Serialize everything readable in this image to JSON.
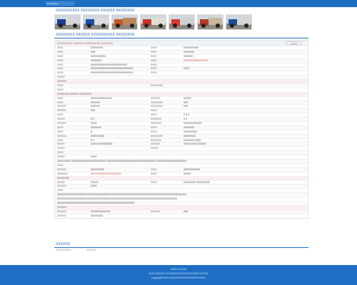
{
  "nav": {
    "current_label": "Homepage ›"
  },
  "page": {
    "title": "XXXXXXXXXX XXXXXXXX XXXXXX XXXXXXXX",
    "section_title": "XXXXXXXX XXXXXX XXXXXXXXXX XXXXXXXX"
  },
  "thumbs": [
    {
      "name": "truck-photo-1",
      "cab": "#1c3f8f",
      "box": "#d7d7d7"
    },
    {
      "name": "truck-photo-2",
      "cab": "#1c4fa2",
      "box": "#dcdcdc"
    },
    {
      "name": "truck-photo-3",
      "cab": "#c4572e",
      "box": "#b98a5c"
    },
    {
      "name": "truck-photo-4",
      "cab": "#cc3528",
      "box": "#e3ddd5"
    },
    {
      "name": "truck-photo-5",
      "cab": "#d23a2e",
      "box": "#cfcfcf"
    },
    {
      "name": "truck-photo-6",
      "cab": "#b53a2d",
      "box": "#c9b79e"
    },
    {
      "name": "truck-photo-7",
      "cab": "#1f4e96",
      "box": "#d6d6d6"
    }
  ],
  "specs": {
    "header": "XXXXXXXX XXXXXX XXXXXXXX XXXXXX",
    "compare_label": "XXXXX",
    "rows": [
      {
        "k1": "XXXX",
        "v1": "XXXXXXXX",
        "k2": "XXXX",
        "v2": "XXXXXXXXXX"
      },
      {
        "k1": "XXXX",
        "v1": "XXX",
        "k2": "XXXX",
        "v2": "XXXXXXX"
      },
      {
        "k1": "XXXX",
        "v1": "XXXXXXXXXX",
        "k2": "XXXX",
        "v2": "XXXXXX"
      },
      {
        "k1": "XXXX",
        "v1": "XXXXXXX",
        "k2": "XXXX",
        "v2": "XXXXXXXXXXXXXXXX",
        "red2": true
      },
      {
        "k1": "XXXX",
        "v1": "XXXXXXXXXXXXXXXXXXXXXXXX",
        "k2": "XXXX",
        "v2": ""
      },
      {
        "k1": "XXXX",
        "v1": "XXXXXXXXXXXXXXXXXXXXXXXXXXXX",
        "k2": "XXXX",
        "v2": "XXXX"
      },
      {
        "k1": "XXXX",
        "v1": "XXXXXXXXXXXXXXXXXXXXXXXXXXXX",
        "k2": "XXXX",
        "v2": ""
      },
      {
        "k1": "XXXXX",
        "v1": "",
        "k2": "",
        "v2": ""
      },
      {
        "head": true,
        "k1": "XXXXXX",
        "v1": "",
        "k2": "",
        "v2": ""
      },
      {
        "k1": "XXXX",
        "v1": "",
        "k2": "XXXXXXXX",
        "v2": ""
      },
      {
        "k1": "XXXX",
        "v1": "",
        "k2": "",
        "v2": ""
      },
      {
        "head": true,
        "k1": "XXXXXXXX XXXXXX XXXXXXXX",
        "v1": "",
        "k2": "",
        "v2": ""
      },
      {
        "k1": "XXXX",
        "v1": "XXXXXXXXXXXXXX",
        "k2": "XXXXXX",
        "v2": "XXXXX"
      },
      {
        "k1": "XXXX",
        "v1": "XXXXXX",
        "k2": "XXXXXXXX",
        "v2": "XXX"
      },
      {
        "k1": "XXXXXX",
        "v1": "XXXXXX",
        "k2": "XXXXXXXX",
        "v2": "XXX"
      },
      {
        "k1": "XXXXXX",
        "v1": "XXX",
        "k2": "XXXX",
        "v2": ""
      },
      {
        "k1": "XXXX",
        "v1": "",
        "k2": "XXXX",
        "v2": "X X X"
      },
      {
        "k1": "XXXXX",
        "v1": "X X",
        "k2": "XXXXXXX",
        "v2": "X X"
      },
      {
        "k1": "XXXXXX",
        "v1": "XXXX",
        "k2": "XXXXXXX",
        "v2": "XXXXXXXXXXXX"
      },
      {
        "k1": "XXXX",
        "v1": "XXXXXXX",
        "k2": "XXXX",
        "v2": "XXXXXXX"
      },
      {
        "k1": "XXXX",
        "v1": "X",
        "k2": "XXXX",
        "v2": "XXXXXXXXX"
      },
      {
        "k1": "XXXXXX",
        "v1": "XXXXXXXXX",
        "k2": "XXXXXXXX",
        "v2": "XXXXXXXX"
      },
      {
        "k1": "XXXX",
        "v1": "X X",
        "k2": "XXXXXXX",
        "v2": "XXXXXXX XXXX"
      },
      {
        "k1": "XXXXX",
        "v1": "XXXX XXXXXXXXXX",
        "k2": "XXXXXX",
        "v2": "XXXX XXXX XXXXXX"
      },
      {
        "k1": "XXXXX",
        "v1": "",
        "k2": "XXXXX",
        "v2": ""
      },
      {
        "k1": "XXXX",
        "v1": "",
        "k2": "",
        "v2": ""
      },
      {
        "k1": "XXXXX",
        "v1": "XXXX",
        "k2": "",
        "v2": ""
      },
      {
        "long": "XXXXXXXXX XXXXXXXXXXXXXXXXXXXXXXX XXXXXXXXXXXXXXXXXXXXXXXXXXXXXXXX XXXXXXXXXXXXXXXXXXXX"
      },
      {
        "k1": "XXXX",
        "v1": "",
        "k2": "",
        "v2": ""
      },
      {
        "k1": "XXXXXX",
        "v1": "XXXXXXXXX",
        "k2": "XXXX",
        "v2": "XXXXXXXXXXX"
      },
      {
        "k1": "XXXXXXX",
        "v1": "XXXXXXXXXXXXXXXXXXXX",
        "k2": "XXXX",
        "v2": "XXXXX",
        "red1": true
      },
      {
        "head": true,
        "k1": "XXXXXXXX",
        "v1": "",
        "k2": "",
        "v2": ""
      },
      {
        "k1": "XXXXX",
        "v1": "XXXXX",
        "k2": "XXXX",
        "v2": "XXXXXXXX XXXXXXXXX"
      },
      {
        "k1": "XXXXXX",
        "v1": "XXXX",
        "k2": "",
        "v2": ""
      },
      {
        "k1": "XXXX",
        "v1": "",
        "k2": "",
        "v2": ""
      },
      {
        "long": "XXXXXXXXXXXXXXXXXXXXXXXXXXXXXXXXXXXXXXXXXXXXXXXXXXXXXXXXXXXXXXXXXXXXXXXXXXXXXXXXXXXXX"
      },
      {
        "long": "XXXXXXXXXXXXXXXXXXXXXXXXXXXXXXXXXXXXXXXXXXXXXXXXXXXXXXXXXXXXXXXXXXXXXXXXXXXXXXX"
      },
      {
        "long": "XXXXXXXXXXXXXXXXXXXXXXXXXXXXXXXXXXXXXXXXXXXXXXXXXXX"
      },
      {
        "head": true,
        "k1": "XXXXXX",
        "v1": "",
        "k2": "",
        "v2": ""
      },
      {
        "k1": "XXXXXX",
        "v1": "XXXXXXXXXXXXX",
        "k2": "XXXXXX",
        "v2": "XXX"
      },
      {
        "k1": "XXXXXX",
        "v1": "XXXXXXXX",
        "k2": "",
        "v2": ""
      }
    ]
  },
  "related": {
    "title": "XXXXXX",
    "links": [
      "XXXXXXXXXX",
      "XXXXXX"
    ]
  },
  "footer": {
    "line1": "XXXXX   XXXXX",
    "line2": "XXXX XXXXXX XXXXXXXXXXXXXXXXXXXXXX XXXXXX",
    "line3": "Copyright©XXXX XXXXXXXXXXXXXXXXXXXXXXXX"
  }
}
